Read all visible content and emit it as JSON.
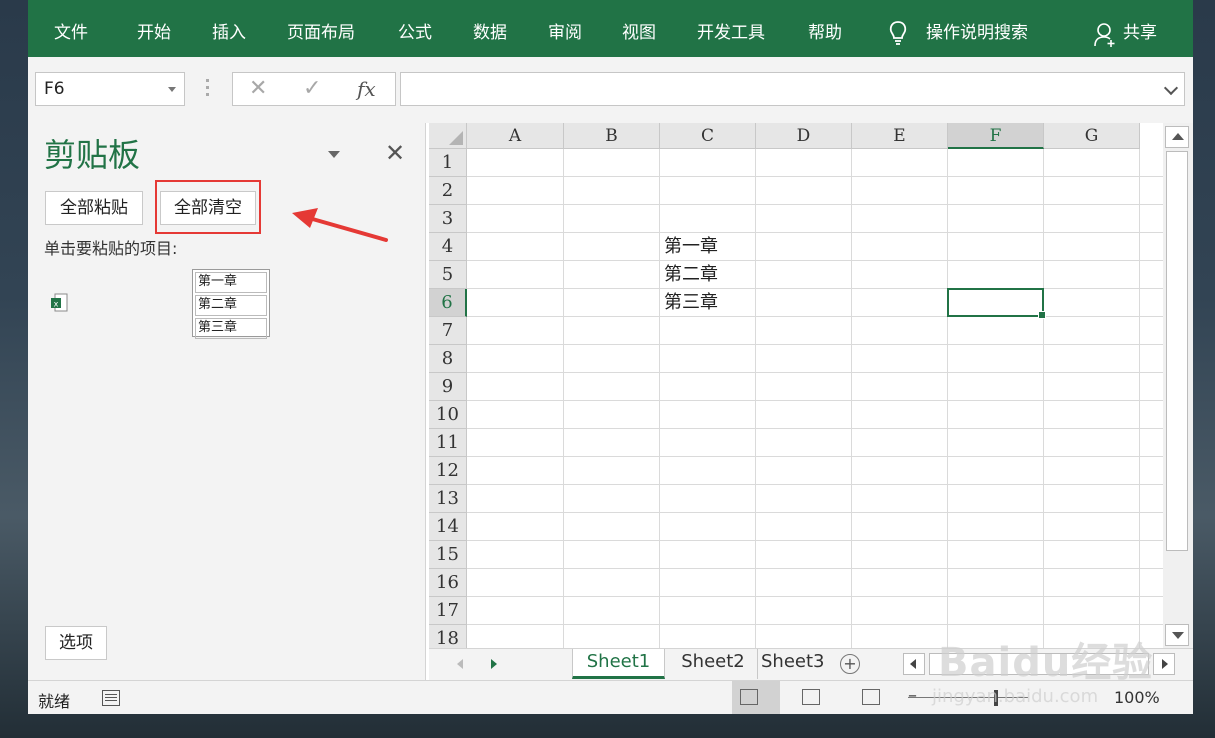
{
  "ribbon": {
    "tabs": [
      "文件",
      "开始",
      "插入",
      "页面布局",
      "公式",
      "数据",
      "审阅",
      "视图",
      "开发工具",
      "帮助"
    ],
    "tell_me": "操作说明搜索",
    "share": "共享"
  },
  "formula_bar": {
    "name_box": "F6",
    "cancel": "✕",
    "enter": "✓",
    "fx": "fx",
    "formula": ""
  },
  "clipboard": {
    "title": "剪贴板",
    "paste_all": "全部粘贴",
    "clear_all": "全部清空",
    "hint": "单击要粘贴的项目:",
    "item_lines": [
      "第一章",
      "第二章",
      "第三章"
    ],
    "options": "选项"
  },
  "grid": {
    "columns": [
      "A",
      "B",
      "C",
      "D",
      "E",
      "F",
      "G"
    ],
    "rows": [
      "1",
      "2",
      "3",
      "4",
      "5",
      "6",
      "7",
      "8",
      "9",
      "10",
      "11",
      "12",
      "13",
      "14",
      "15",
      "16",
      "17",
      "18"
    ],
    "selected_cell": "F6",
    "cells": {
      "C4": "第一章",
      "C5": "第二章",
      "C6": "第三章"
    }
  },
  "sheets": [
    "Sheet1",
    "Sheet2",
    "Sheet3 ..."
  ],
  "add_sheet": "+",
  "status": {
    "ready": "就绪",
    "zoom": "100%"
  },
  "watermark": {
    "logo": "Baidu经验",
    "url": "jingyan.baidu.com"
  },
  "colors": {
    "accent": "#217346",
    "highlight": "#e53935"
  }
}
